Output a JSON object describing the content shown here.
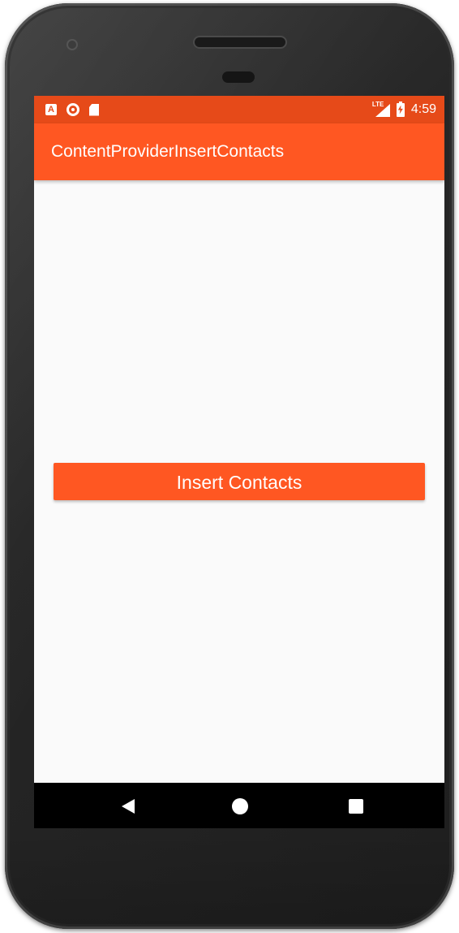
{
  "status_bar": {
    "left_icons": [
      "a-icon",
      "record-icon",
      "sd-card-icon"
    ],
    "a_icon_letter": "A",
    "network_label": "LTE",
    "time": "4:59"
  },
  "app_bar": {
    "title": "ContentProviderInsertContacts"
  },
  "main": {
    "insert_button_label": "Insert Contacts"
  },
  "nav_bar": {
    "buttons": [
      "back-icon",
      "home-icon",
      "recents-icon"
    ]
  },
  "colors": {
    "primary": "#ff5722",
    "primary_dark": "#e64a19",
    "background": "#fafafa",
    "nav_bar": "#000000"
  }
}
